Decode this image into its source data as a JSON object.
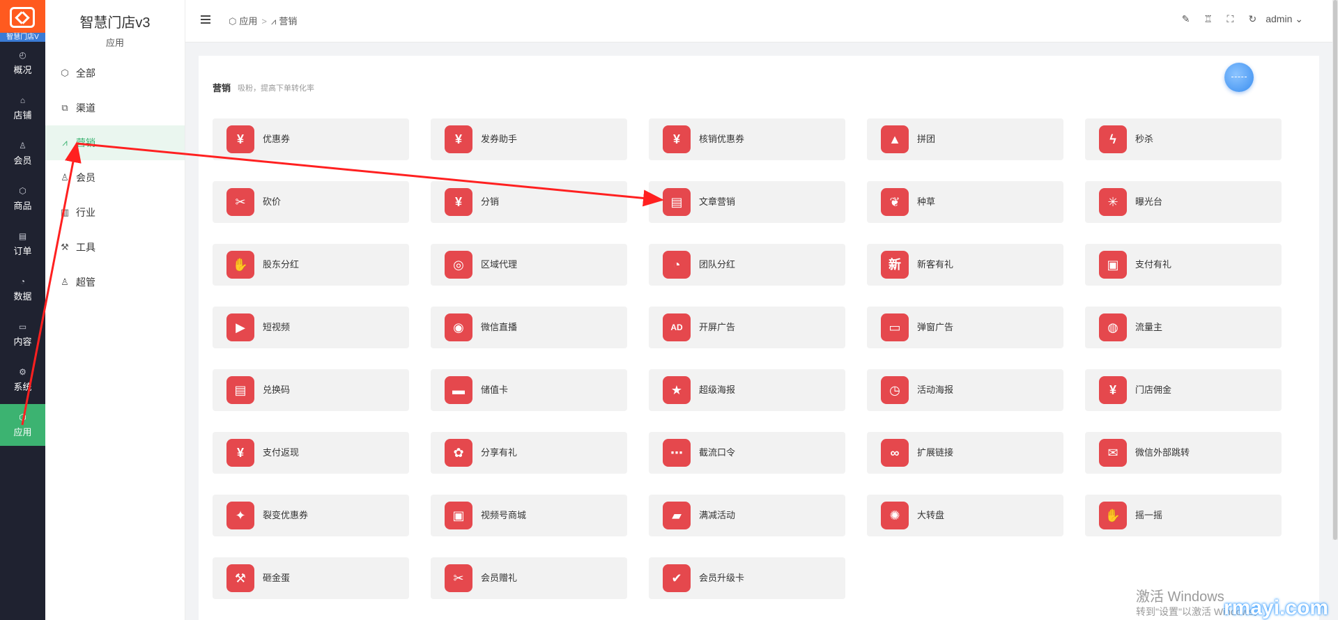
{
  "rail": {
    "logo_text": "智慧门店V",
    "items": [
      {
        "label": "概况",
        "icon": "dashboard-icon"
      },
      {
        "label": "店铺",
        "icon": "store-icon"
      },
      {
        "label": "会员",
        "icon": "user-icon"
      },
      {
        "label": "商品",
        "icon": "box-icon"
      },
      {
        "label": "订单",
        "icon": "order-icon"
      },
      {
        "label": "数据",
        "icon": "chart-pie-icon"
      },
      {
        "label": "内容",
        "icon": "folder-icon"
      },
      {
        "label": "系统",
        "icon": "gear-icon"
      },
      {
        "label": "应用",
        "icon": "cube-icon"
      }
    ],
    "active_color": "#3cb371"
  },
  "sidebar": {
    "title": "智慧门店v3",
    "subtitle": "应用",
    "items": [
      {
        "label": "全部",
        "icon": "cube-icon"
      },
      {
        "label": "渠道",
        "icon": "channel-icon"
      },
      {
        "label": "营销",
        "icon": "marketing-icon"
      },
      {
        "label": "会员",
        "icon": "user-icon"
      },
      {
        "label": "行业",
        "icon": "industry-icon"
      },
      {
        "label": "工具",
        "icon": "wrench-icon"
      },
      {
        "label": "超管",
        "icon": "admin-icon"
      }
    ]
  },
  "header": {
    "breadcrumb": [
      "应用",
      ">",
      "营销"
    ],
    "user": "admin"
  },
  "section": {
    "title": "营销",
    "subtitle": "吸粉，提高下单转化率"
  },
  "apps": [
    {
      "label": "优惠券",
      "icon": "coupon-icon",
      "glyph": "¥"
    },
    {
      "label": "发券助手",
      "icon": "coupon-send-icon",
      "glyph": "¥"
    },
    {
      "label": "核销优惠券",
      "icon": "coupon-verify-icon",
      "glyph": "¥"
    },
    {
      "label": "拼团",
      "icon": "group-buy-icon",
      "glyph": "▲"
    },
    {
      "label": "秒杀",
      "icon": "flash-icon",
      "glyph": "ϟ"
    },
    {
      "label": "砍价",
      "icon": "bargain-icon",
      "glyph": "✂"
    },
    {
      "label": "分销",
      "icon": "distribution-icon",
      "glyph": "¥"
    },
    {
      "label": "文章营销",
      "icon": "article-icon",
      "glyph": "▤"
    },
    {
      "label": "种草",
      "icon": "sprout-icon",
      "glyph": "❦"
    },
    {
      "label": "曝光台",
      "icon": "sun-icon",
      "glyph": "✳"
    },
    {
      "label": "股东分红",
      "icon": "dividend-icon",
      "glyph": "✋"
    },
    {
      "label": "区域代理",
      "icon": "region-icon",
      "glyph": "◎"
    },
    {
      "label": "团队分红",
      "icon": "pie-icon",
      "glyph": "◔"
    },
    {
      "label": "新客有礼",
      "icon": "new-customer-icon",
      "glyph": "新"
    },
    {
      "label": "支付有礼",
      "icon": "gift-icon",
      "glyph": "▣"
    },
    {
      "label": "短视频",
      "icon": "video-icon",
      "glyph": "▶"
    },
    {
      "label": "微信直播",
      "icon": "live-icon",
      "glyph": "◉"
    },
    {
      "label": "开屏广告",
      "icon": "ad-icon",
      "glyph": "AD"
    },
    {
      "label": "弹窗广告",
      "icon": "popup-ad-icon",
      "glyph": "▭"
    },
    {
      "label": "流量主",
      "icon": "traffic-icon",
      "glyph": "◍"
    },
    {
      "label": "兑换码",
      "icon": "redeem-icon",
      "glyph": "▤"
    },
    {
      "label": "储值卡",
      "icon": "card-icon",
      "glyph": "▬"
    },
    {
      "label": "超级海报",
      "icon": "poster-icon",
      "glyph": "★"
    },
    {
      "label": "活动海报",
      "icon": "event-poster-icon",
      "glyph": "◷"
    },
    {
      "label": "门店佣金",
      "icon": "commission-icon",
      "glyph": "¥"
    },
    {
      "label": "支付返现",
      "icon": "cashback-icon",
      "glyph": "¥"
    },
    {
      "label": "分享有礼",
      "icon": "share-gift-icon",
      "glyph": "✿"
    },
    {
      "label": "截流口令",
      "icon": "password-icon",
      "glyph": "⋯"
    },
    {
      "label": "扩展链接",
      "icon": "link-icon",
      "glyph": "∞"
    },
    {
      "label": "微信外部跳转",
      "icon": "wechat-icon",
      "glyph": "✉"
    },
    {
      "label": "裂变优惠券",
      "icon": "fission-coupon-icon",
      "glyph": "✦"
    },
    {
      "label": "视频号商城",
      "icon": "channel-mall-icon",
      "glyph": "▣"
    },
    {
      "label": "满减活动",
      "icon": "discount-icon",
      "glyph": "▰"
    },
    {
      "label": "大转盘",
      "icon": "wheel-icon",
      "glyph": "✺"
    },
    {
      "label": "摇一摇",
      "icon": "shake-icon",
      "glyph": "✋"
    },
    {
      "label": "砸金蛋",
      "icon": "egg-icon",
      "glyph": "⚒"
    },
    {
      "label": "会员赠礼",
      "icon": "member-gift-icon",
      "glyph": "✂"
    },
    {
      "label": "会员升级卡",
      "icon": "member-upgrade-icon",
      "glyph": "✔"
    }
  ],
  "watermark": {
    "line1": "激活 Windows",
    "line2": "转到\"设置\"以激活 Windows。",
    "brand": "rmayi.com"
  },
  "colors": {
    "tile_icon": "#e5484d",
    "arrow": "#ff2020"
  }
}
